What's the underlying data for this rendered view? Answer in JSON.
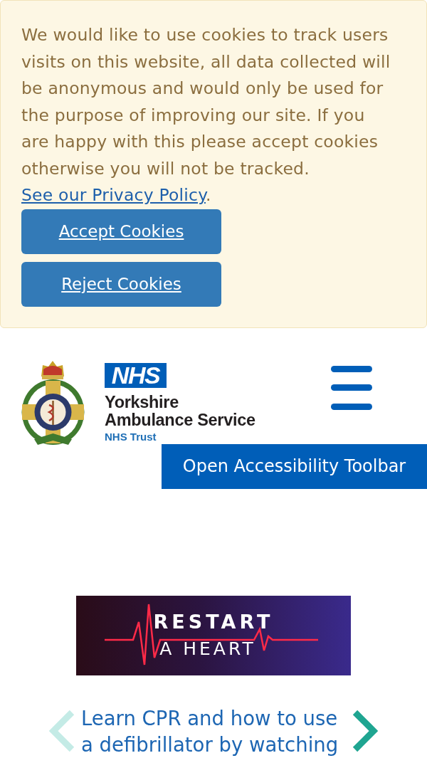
{
  "cookie_banner": {
    "message": "We would like to use cookies to track users visits on this website, all data collected will be anonymous and would only be used for the purpose of improving our site. If you are happy with this please accept cookies otherwise you will not be tracked. ",
    "link": "See our Privacy Policy",
    "message_end": ".",
    "buttons": [
      "Accept Cookies",
      "Reject Cookies"
    ]
  },
  "header": {
    "logo": {
      "badge": "NHS",
      "name_lines": [
        "Yorkshire",
        "Ambulance Service"
      ],
      "subtitle": "NHS Trust"
    },
    "accessibility_button": "Open Accessibility Toolbar"
  },
  "promo_banner": {
    "lines": [
      "RESTART",
      "A HEART"
    ]
  },
  "carousel": {
    "text": "Learn CPR and how to use a defibrillator by watching",
    "prev": {
      "disabled": true
    },
    "next": {
      "disabled": false
    }
  }
}
